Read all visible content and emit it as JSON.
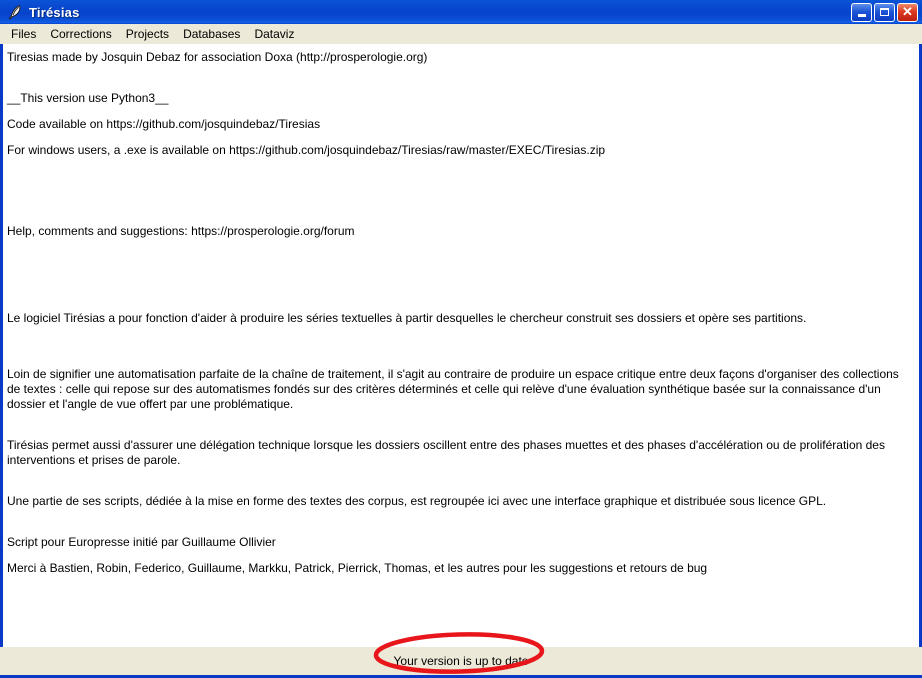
{
  "window": {
    "title": "Tirésias",
    "icon": "quill-pen-icon",
    "accent_color": "#0A39C8",
    "titlebar_gradient_from": "#0A55D8",
    "titlebar_gradient_to": "#0A39C8",
    "chrome_color": "#ECE9D8",
    "buttons": {
      "minimize": "minimize-icon",
      "maximize": "maximize-icon",
      "close": "close-icon"
    }
  },
  "menubar": {
    "items": [
      {
        "label": "Files"
      },
      {
        "label": "Corrections"
      },
      {
        "label": "Projects"
      },
      {
        "label": "Databases"
      },
      {
        "label": "Dataviz"
      }
    ]
  },
  "content": {
    "credit_line": "Tiresias made by Josquin Debaz for association Doxa (http://prosperologie.org)",
    "python_version_line": "__This version use Python3__",
    "code_line": "Code available on https://github.com/josquindebaz/Tiresias",
    "windows_exe_line": "For windows users, a .exe is available on https://github.com/josquindebaz/Tiresias/raw/master/EXEC/Tiresias.zip",
    "help_line": "Help, comments and suggestions: https://prosperologie.org/forum",
    "paragraph_1": "Le logiciel Tirésias a pour fonction d'aider à produire les séries textuelles à partir desquelles le chercheur construit ses dossiers et opère ses partitions.",
    "paragraph_2": "Loin de signifier une automatisation parfaite de la chaîne de traitement, il s'agit au contraire de produire un espace critique entre deux façons d'organiser des collections de textes : celle qui repose sur des automatismes fondés sur des critères déterminés et celle qui relève d'une évaluation synthétique basée sur la connaissance d'un dossier et l'angle de vue offert par une problématique.",
    "paragraph_3": "Tirésias permet aussi d'assurer une délégation technique lorsque les dossiers oscillent entre des phases muettes et des phases d'accélération ou de prolifération des interventions et prises de parole.",
    "paragraph_4": "Une partie de ses scripts, dédiée à la mise en forme des textes des corpus, est regroupée ici avec une interface graphique et distribuée sous licence GPL.",
    "script_line": "Script pour Europresse initié par Guillaume Ollivier",
    "thanks_line": "Merci à Bastien, Robin, Federico, Guillaume, Markku, Patrick, Pierrick, Thomas, et les autres pour les suggestions et retours de bug"
  },
  "statusbar": {
    "text": "Your version is up to date"
  },
  "annotation": {
    "shape": "ellipse",
    "color": "#E8151A",
    "target": "Your version is up to date"
  }
}
